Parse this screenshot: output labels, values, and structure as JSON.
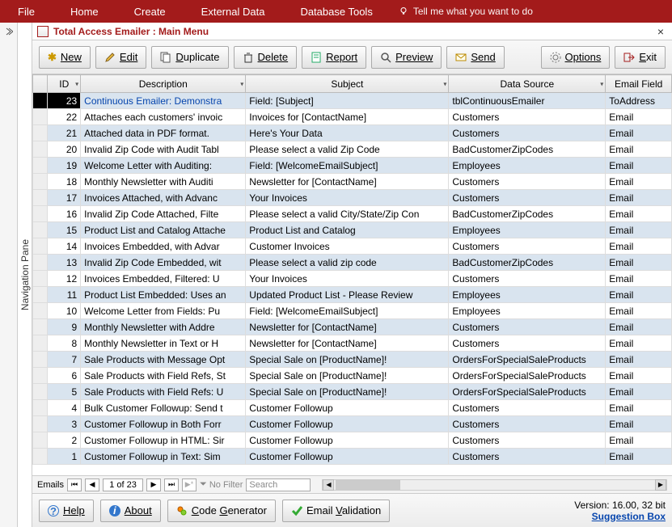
{
  "ribbon": {
    "items": [
      "File",
      "Home",
      "Create",
      "External Data",
      "Database Tools"
    ],
    "tell_me": "Tell me what you want to do"
  },
  "tab": {
    "title": "Total Access Emailer : Main Menu"
  },
  "toolbar": {
    "new": "New",
    "edit": "Edit",
    "duplicate": "Duplicate",
    "delete": "Delete",
    "report": "Report",
    "preview": "Preview",
    "send": "Send",
    "options": "Options",
    "exit": "Exit"
  },
  "columns": {
    "id": "ID",
    "description": "Description",
    "subject": "Subject",
    "data_source": "Data Source",
    "email_field": "Email Field"
  },
  "rows": [
    {
      "id": "23",
      "desc": "Continuous Emailer: Demonstra",
      "subj": "Field: [Subject]",
      "src": "tblContinuousEmailer",
      "ef": "ToAddress",
      "selected": true,
      "link": true
    },
    {
      "id": "22",
      "desc": "Attaches each customers' invoic",
      "subj": "Invoices for [ContactName]",
      "src": "Customers",
      "ef": "Email"
    },
    {
      "id": "21",
      "desc": "Attached data in PDF format.",
      "subj": "Here's Your Data",
      "src": "Customers",
      "ef": "Email"
    },
    {
      "id": "20",
      "desc": "Invalid Zip Code with Audit Tabl",
      "subj": "Please select a valid Zip Code",
      "src": "BadCustomerZipCodes",
      "ef": "Email"
    },
    {
      "id": "19",
      "desc": "Welcome Letter with Auditing:",
      "subj": "Field: [WelcomeEmailSubject]",
      "src": "Employees",
      "ef": "Email"
    },
    {
      "id": "18",
      "desc": "Monthly Newsletter with Auditi",
      "subj": "Newsletter for [ContactName]",
      "src": "Customers",
      "ef": "Email"
    },
    {
      "id": "17",
      "desc": "Invoices Attached, with Advanc",
      "subj": "Your Invoices",
      "src": "Customers",
      "ef": "Email"
    },
    {
      "id": "16",
      "desc": "Invalid Zip Code Attached, Filte",
      "subj": "Please select a valid City/State/Zip Con",
      "src": "BadCustomerZipCodes",
      "ef": "Email"
    },
    {
      "id": "15",
      "desc": "Product List and Catalog Attache",
      "subj": "Product List and Catalog",
      "src": "Employees",
      "ef": "Email"
    },
    {
      "id": "14",
      "desc": "Invoices Embedded, with Advar",
      "subj": "Customer Invoices",
      "src": "Customers",
      "ef": "Email"
    },
    {
      "id": "13",
      "desc": "Invalid Zip Code Embedded, wit",
      "subj": "Please select a valid zip code",
      "src": "BadCustomerZipCodes",
      "ef": "Email"
    },
    {
      "id": "12",
      "desc": "Invoices Embedded, Filtered: U",
      "subj": "Your Invoices",
      "src": "Customers",
      "ef": "Email"
    },
    {
      "id": "11",
      "desc": "Product List Embedded: Uses an",
      "subj": "Updated Product List - Please Review",
      "src": "Employees",
      "ef": "Email"
    },
    {
      "id": "10",
      "desc": "Welcome Letter from Fields: Pu",
      "subj": "Field: [WelcomeEmailSubject]",
      "src": "Employees",
      "ef": "Email"
    },
    {
      "id": "9",
      "desc": "Monthly Newsletter with Addre",
      "subj": "Newsletter for [ContactName]",
      "src": "Customers",
      "ef": "Email"
    },
    {
      "id": "8",
      "desc": "Monthly Newsletter in Text or H",
      "subj": "Newsletter for [ContactName]",
      "src": "Customers",
      "ef": "Email"
    },
    {
      "id": "7",
      "desc": "Sale Products with Message Opt",
      "subj": "Special Sale on [ProductName]!",
      "src": "OrdersForSpecialSaleProducts",
      "ef": "Email"
    },
    {
      "id": "6",
      "desc": "Sale Products with Field Refs, St",
      "subj": "Special Sale on [ProductName]!",
      "src": "OrdersForSpecialSaleProducts",
      "ef": "Email"
    },
    {
      "id": "5",
      "desc": "Sale Products with Field Refs: U",
      "subj": "Special Sale on [ProductName]!",
      "src": "OrdersForSpecialSaleProducts",
      "ef": "Email"
    },
    {
      "id": "4",
      "desc": "Bulk Customer Followup: Send t",
      "subj": "Customer Followup",
      "src": "Customers",
      "ef": "Email"
    },
    {
      "id": "3",
      "desc": "Customer Followup in Both Forr",
      "subj": "Customer Followup",
      "src": "Customers",
      "ef": "Email"
    },
    {
      "id": "2",
      "desc": "Customer Followup in HTML: Sir",
      "subj": "Customer Followup",
      "src": "Customers",
      "ef": "Email"
    },
    {
      "id": "1",
      "desc": "Customer Followup in Text: Sim",
      "subj": "Customer Followup",
      "src": "Customers",
      "ef": "Email"
    }
  ],
  "nav_record": {
    "label": "Emails",
    "pos": "1 of 23",
    "no_filter": "No Filter",
    "search": "Search"
  },
  "nav_pane": {
    "label": "Navigation Pane"
  },
  "footer": {
    "help": "Help",
    "about": "About",
    "code_gen": "Code Generator",
    "email_val": "Email Validation",
    "version": "Version: 16.00, 32 bit",
    "suggestion": "Suggestion Box"
  }
}
